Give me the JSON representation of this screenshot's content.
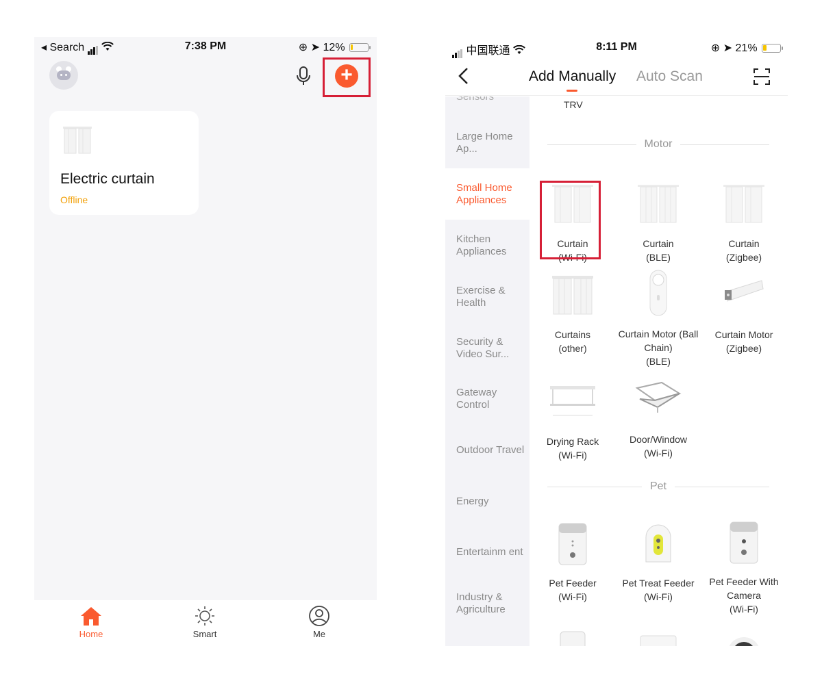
{
  "left_phone": {
    "status": {
      "back_label": "◂ Search",
      "time": "7:38 PM",
      "battery": "12%",
      "battery_fraction": 0.12
    },
    "device": {
      "name": "Electric curtain",
      "state": "Offline"
    },
    "tabs": [
      {
        "label": "Home"
      },
      {
        "label": "Smart"
      },
      {
        "label": "Me"
      }
    ],
    "colors": {
      "accent": "#fa5a2f",
      "offline": "#f2a10a",
      "highlight": "#d61f36"
    }
  },
  "right_phone": {
    "status": {
      "carrier": "中国联通",
      "time": "8:11 PM",
      "battery": "21%",
      "battery_fraction": 0.21
    },
    "nav": {
      "tab_active": "Add Manually",
      "tab_inactive": "Auto Scan"
    },
    "sidebar": {
      "cut_item": "Sensors",
      "items": [
        {
          "label": "Large Home Ap..."
        },
        {
          "label": "Small Home Appliances"
        },
        {
          "label": "Kitchen Appliances"
        },
        {
          "label": "Exercise & Health"
        },
        {
          "label": "Security & Video Sur..."
        },
        {
          "label": "Gateway Control"
        },
        {
          "label": "Outdoor Travel"
        },
        {
          "label": "Energy"
        },
        {
          "label": "Entertainm ent"
        },
        {
          "label": "Industry & Agriculture"
        }
      ]
    },
    "main": {
      "top_item": "TRV",
      "sections": [
        {
          "title": "Motor"
        },
        {
          "title": "Pet"
        }
      ],
      "products": [
        {
          "name": "Curtain",
          "sub": "(Wi-Fi)"
        },
        {
          "name": "Curtain",
          "sub": "(BLE)"
        },
        {
          "name": "Curtain",
          "sub": "(Zigbee)"
        },
        {
          "name": "Curtains",
          "sub": "(other)"
        },
        {
          "name": "Curtain Motor (Ball Chain)",
          "sub": "(BLE)"
        },
        {
          "name": "Curtain Motor",
          "sub": "(Zigbee)"
        },
        {
          "name": "Drying Rack",
          "sub": "(Wi-Fi)"
        },
        {
          "name": "Door/Window",
          "sub": "(Wi-Fi)"
        },
        {
          "name": "Pet Feeder",
          "sub": "(Wi-Fi)"
        },
        {
          "name": "Pet Treat Feeder",
          "sub": "(Wi-Fi)"
        },
        {
          "name": "Pet Feeder With Camera",
          "sub": "(Wi-Fi)"
        }
      ]
    }
  }
}
